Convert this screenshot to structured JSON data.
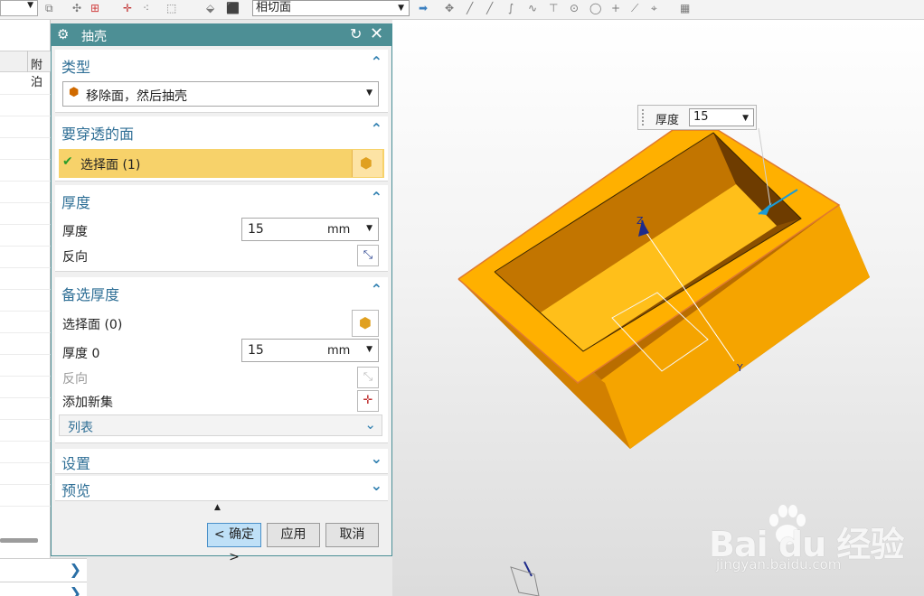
{
  "toolbar": {
    "surface_rule": "相切面"
  },
  "navigator": {
    "column_header": "附泊"
  },
  "dialog": {
    "title": "抽壳",
    "sections": {
      "type": {
        "title": "类型",
        "value": "移除面，然后抽壳"
      },
      "faces_to_pierce": {
        "title": "要穿透的面",
        "select_face": "选择面 (1)"
      },
      "thickness": {
        "title": "厚度",
        "thickness_label": "厚度",
        "thickness_value": "15",
        "unit": "mm",
        "reverse_label": "反向"
      },
      "alternate_thickness": {
        "title": "备选厚度",
        "select_face": "选择面 (0)",
        "thickness_label": "厚度 0",
        "thickness_value": "15",
        "unit": "mm",
        "reverse_label": "反向",
        "add_new_set_label": "添加新集",
        "list_label": "列表"
      },
      "settings": {
        "title": "设置"
      },
      "preview": {
        "title": "预览"
      }
    },
    "buttons": {
      "ok": "< 确定 >",
      "apply": "应用",
      "cancel": "取消"
    }
  },
  "viewport": {
    "thickness_box": {
      "label": "厚度",
      "value": "15"
    },
    "axis_z": "Z",
    "axis_y": "Y"
  },
  "watermark": {
    "brand": "Bai du 经验",
    "url": "jingyan.baidu.com"
  },
  "colors": {
    "title_bar": "#4d8f95",
    "section_title": "#2f6f96",
    "selection_row": "#f7d26a",
    "model_top": "#ffb000",
    "model_side": "#b96d00",
    "ok_button": "#bfe0f7"
  }
}
